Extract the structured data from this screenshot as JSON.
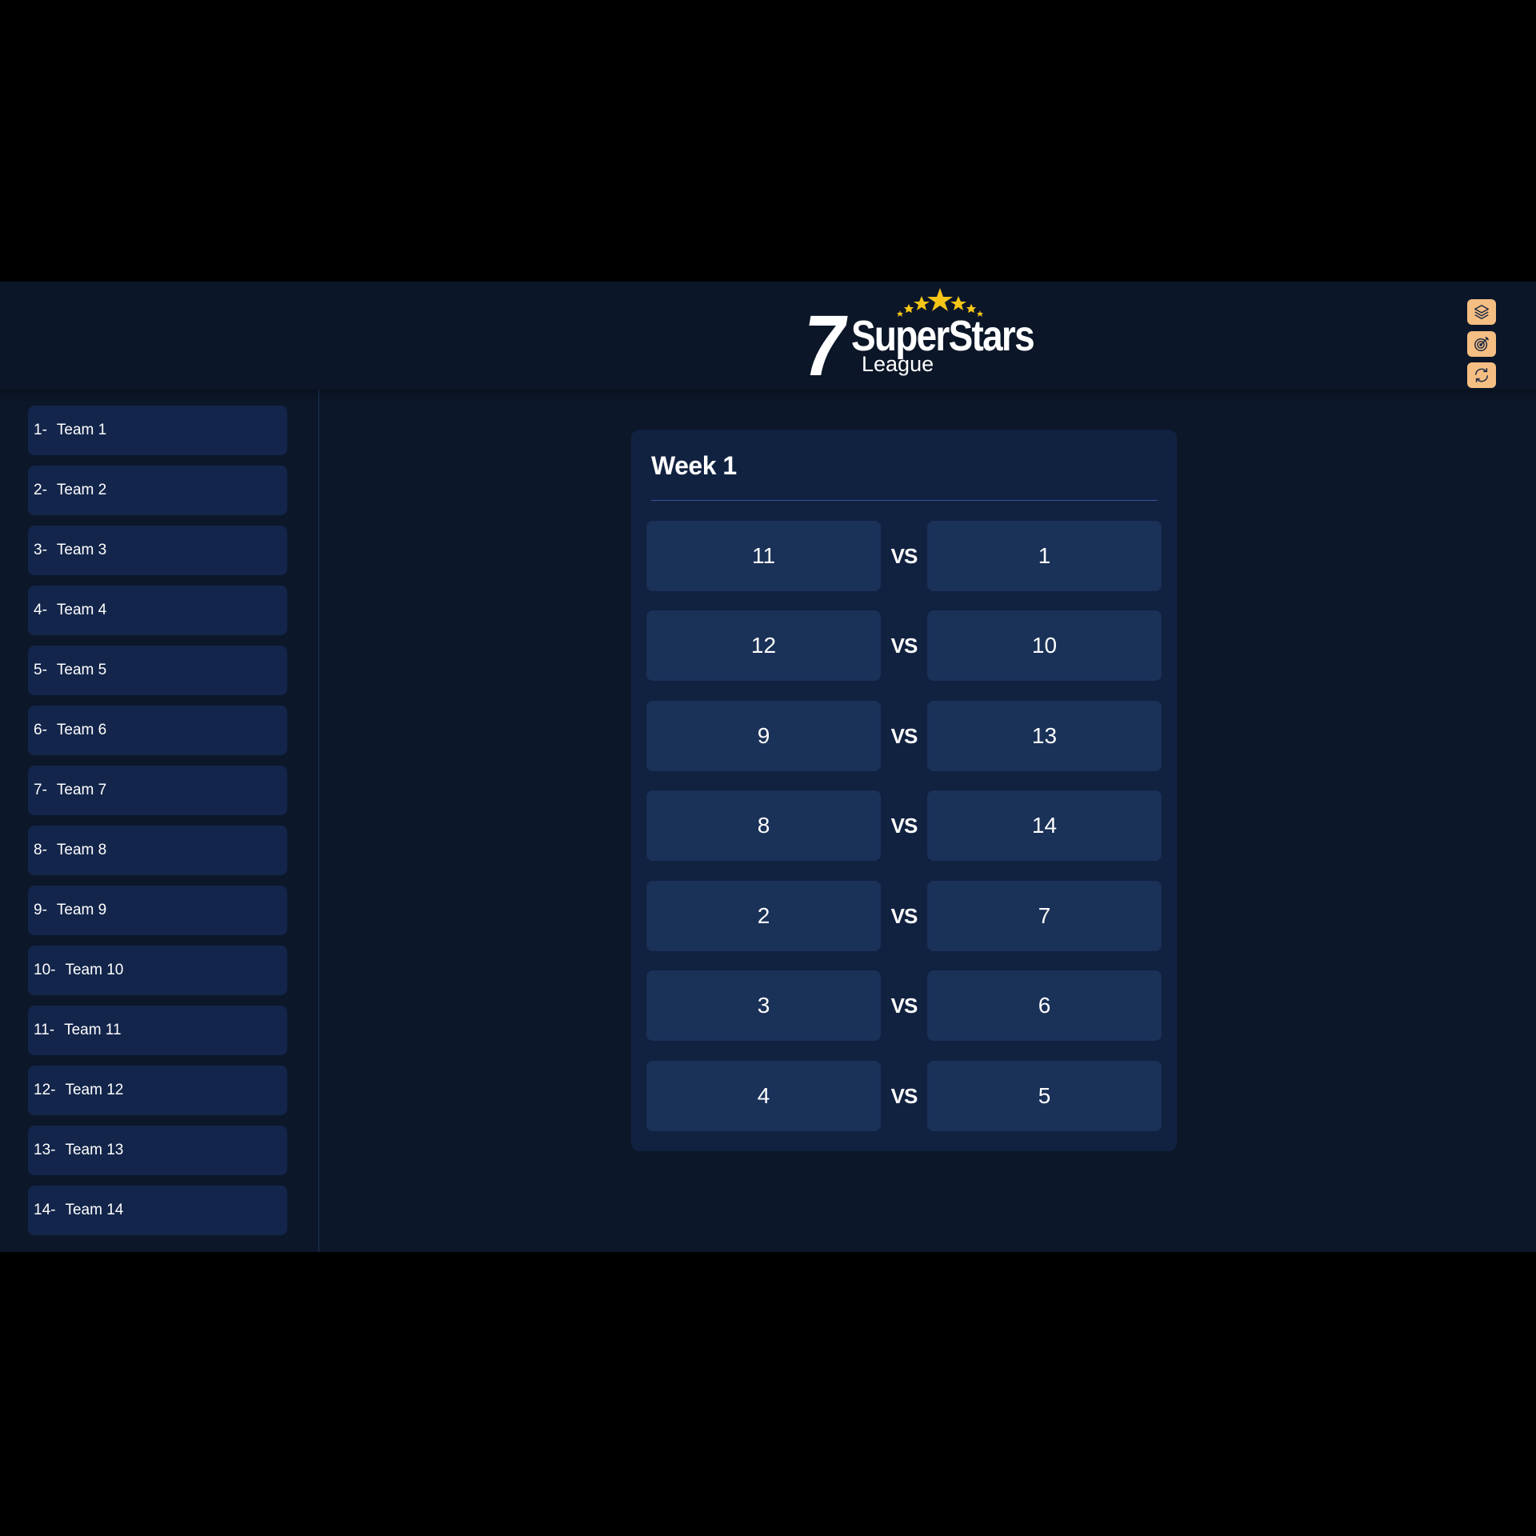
{
  "header": {
    "logo": {
      "number": "7",
      "title": "SuperStars",
      "subtitle": "League",
      "star_color": "#f5c518"
    },
    "tools": [
      {
        "icon": "layers-icon"
      },
      {
        "icon": "target-icon"
      },
      {
        "icon": "refresh-icon"
      }
    ],
    "tool_color": "#f5be82"
  },
  "sidebar": {
    "teams": [
      {
        "num": "1-",
        "name": "Team 1"
      },
      {
        "num": "2-",
        "name": "Team 2"
      },
      {
        "num": "3-",
        "name": "Team 3"
      },
      {
        "num": "4-",
        "name": "Team 4"
      },
      {
        "num": "5-",
        "name": "Team 5"
      },
      {
        "num": "6-",
        "name": "Team 6"
      },
      {
        "num": "7-",
        "name": "Team 7"
      },
      {
        "num": "8-",
        "name": "Team 8"
      },
      {
        "num": "9-",
        "name": "Team 9"
      },
      {
        "num": "10-",
        "name": "Team 10"
      },
      {
        "num": "11-",
        "name": "Team 11"
      },
      {
        "num": "12-",
        "name": "Team 12"
      },
      {
        "num": "13-",
        "name": "Team 13"
      },
      {
        "num": "14-",
        "name": "Team 14"
      }
    ]
  },
  "schedule": {
    "title": "Week 1",
    "vs_label": "VS",
    "matches": [
      {
        "home": "11",
        "away": "1"
      },
      {
        "home": "12",
        "away": "10"
      },
      {
        "home": "9",
        "away": "13"
      },
      {
        "home": "8",
        "away": "14"
      },
      {
        "home": "2",
        "away": "7"
      },
      {
        "home": "3",
        "away": "6"
      },
      {
        "home": "4",
        "away": "5"
      }
    ]
  },
  "colors": {
    "background": "#0c1729",
    "panel": "#112140",
    "team_item": "#13254a",
    "match_box": "#1a3158",
    "divider": "#37539a"
  }
}
